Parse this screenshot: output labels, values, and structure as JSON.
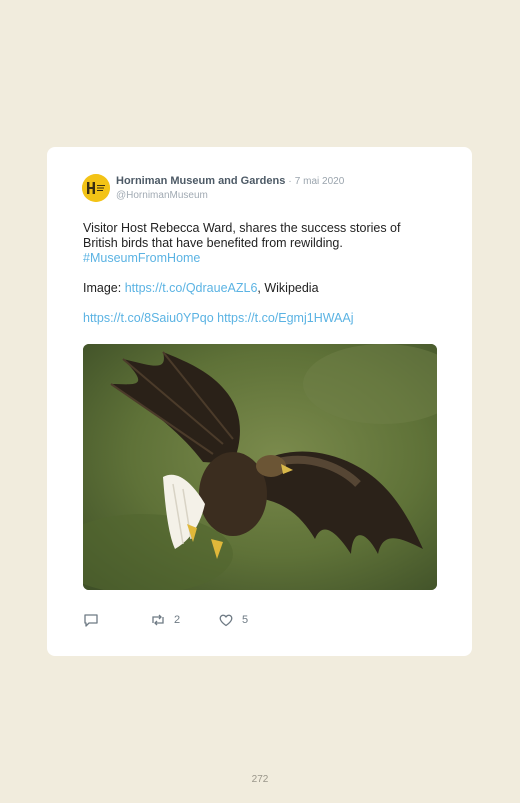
{
  "tweet": {
    "author_name": "Horniman Museum and Gardens",
    "separator": "·",
    "date": "7 mai 2020",
    "handle": "@HornimanMuseum",
    "avatar_letter": "H",
    "text_line1": "Visitor Host Rebecca Ward, shares the success stories of British birds that have benefited from rewilding.",
    "hashtag": "#MuseumFromHome",
    "image_prefix": "Image: ",
    "image_link": "https://t.co/QdraueAZL6",
    "image_suffix": ", Wikipedia",
    "link1": "https://t.co/8Saiu0YPqo",
    "link2": "https://t.co/Egmj1HWAAj",
    "actions": {
      "reply_icon": "reply-icon",
      "retweet_icon": "retweet-icon",
      "retweet_count": "2",
      "like_icon": "heart-icon",
      "like_count": "5"
    }
  },
  "page": {
    "number": "272"
  },
  "colors": {
    "background": "#f1ecdd",
    "link": "#5bb3e3",
    "avatar": "#f3c316"
  }
}
